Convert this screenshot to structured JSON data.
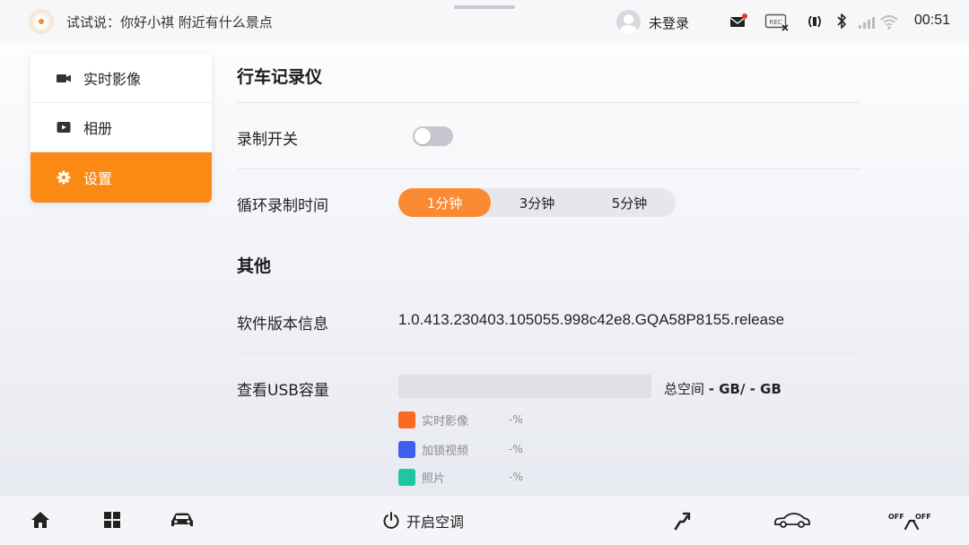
{
  "statusbar": {
    "voice_hint": "试试说：你好小祺 附近有什么景点",
    "login_label": "未登录",
    "time": "00:51",
    "rec_label": "REC",
    "icons": [
      "message-icon",
      "rec-icon",
      "nfc-icon",
      "bluetooth-icon",
      "signal-icon",
      "wifi-icon"
    ]
  },
  "sidebar": {
    "items": [
      {
        "label": "实时影像",
        "icon": "camera-icon"
      },
      {
        "label": "相册",
        "icon": "play-icon"
      },
      {
        "label": "设置",
        "icon": "gear-icon",
        "active": true
      }
    ]
  },
  "main": {
    "section_title": "行车记录仪",
    "recording_switch": {
      "label": "录制开关",
      "on": false
    },
    "loop_recording": {
      "label": "循环录制时间",
      "options": [
        "1分钟",
        "3分钟",
        "5分钟"
      ],
      "selected": "1分钟"
    },
    "other_title": "其他",
    "version": {
      "label": "软件版本信息",
      "value": "1.0.413.230403.105055.998c42e8.GQA58P8155.release"
    },
    "usb": {
      "label": "查看USB容量",
      "total_prefix": "总空间",
      "total_value": "- GB/ - GB",
      "legend": [
        {
          "label": "实时影像",
          "value": "-%",
          "color": "#fb6a22"
        },
        {
          "label": "加锁视频",
          "value": "-%",
          "color": "#3f5ef0"
        },
        {
          "label": "照片",
          "value": "-%",
          "color": "#1fc6a0"
        }
      ]
    }
  },
  "dock": {
    "ac_label": "开启空调",
    "icons": [
      "home-icon",
      "apps-icon",
      "car-icon",
      "power-icon",
      "seat-icon",
      "car-side-icon",
      "defrost-off-icon"
    ],
    "defrost_left": "OFF",
    "defrost_right": "OFF"
  },
  "colors": {
    "accent": "#fb8a15",
    "segment_active": "#fb8a32"
  }
}
